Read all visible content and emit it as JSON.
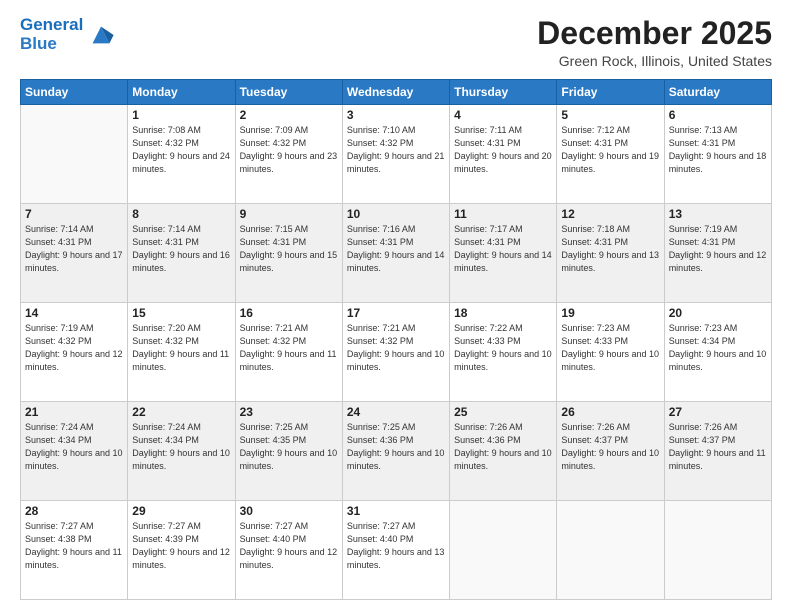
{
  "logo": {
    "line1": "General",
    "line2": "Blue"
  },
  "title": "December 2025",
  "location": "Green Rock, Illinois, United States",
  "weekdays": [
    "Sunday",
    "Monday",
    "Tuesday",
    "Wednesday",
    "Thursday",
    "Friday",
    "Saturday"
  ],
  "weeks": [
    [
      {
        "day": "",
        "sunrise": "",
        "sunset": "",
        "daylight": ""
      },
      {
        "day": "1",
        "sunrise": "Sunrise: 7:08 AM",
        "sunset": "Sunset: 4:32 PM",
        "daylight": "Daylight: 9 hours and 24 minutes."
      },
      {
        "day": "2",
        "sunrise": "Sunrise: 7:09 AM",
        "sunset": "Sunset: 4:32 PM",
        "daylight": "Daylight: 9 hours and 23 minutes."
      },
      {
        "day": "3",
        "sunrise": "Sunrise: 7:10 AM",
        "sunset": "Sunset: 4:32 PM",
        "daylight": "Daylight: 9 hours and 21 minutes."
      },
      {
        "day": "4",
        "sunrise": "Sunrise: 7:11 AM",
        "sunset": "Sunset: 4:31 PM",
        "daylight": "Daylight: 9 hours and 20 minutes."
      },
      {
        "day": "5",
        "sunrise": "Sunrise: 7:12 AM",
        "sunset": "Sunset: 4:31 PM",
        "daylight": "Daylight: 9 hours and 19 minutes."
      },
      {
        "day": "6",
        "sunrise": "Sunrise: 7:13 AM",
        "sunset": "Sunset: 4:31 PM",
        "daylight": "Daylight: 9 hours and 18 minutes."
      }
    ],
    [
      {
        "day": "7",
        "sunrise": "Sunrise: 7:14 AM",
        "sunset": "Sunset: 4:31 PM",
        "daylight": "Daylight: 9 hours and 17 minutes."
      },
      {
        "day": "8",
        "sunrise": "Sunrise: 7:14 AM",
        "sunset": "Sunset: 4:31 PM",
        "daylight": "Daylight: 9 hours and 16 minutes."
      },
      {
        "day": "9",
        "sunrise": "Sunrise: 7:15 AM",
        "sunset": "Sunset: 4:31 PM",
        "daylight": "Daylight: 9 hours and 15 minutes."
      },
      {
        "day": "10",
        "sunrise": "Sunrise: 7:16 AM",
        "sunset": "Sunset: 4:31 PM",
        "daylight": "Daylight: 9 hours and 14 minutes."
      },
      {
        "day": "11",
        "sunrise": "Sunrise: 7:17 AM",
        "sunset": "Sunset: 4:31 PM",
        "daylight": "Daylight: 9 hours and 14 minutes."
      },
      {
        "day": "12",
        "sunrise": "Sunrise: 7:18 AM",
        "sunset": "Sunset: 4:31 PM",
        "daylight": "Daylight: 9 hours and 13 minutes."
      },
      {
        "day": "13",
        "sunrise": "Sunrise: 7:19 AM",
        "sunset": "Sunset: 4:31 PM",
        "daylight": "Daylight: 9 hours and 12 minutes."
      }
    ],
    [
      {
        "day": "14",
        "sunrise": "Sunrise: 7:19 AM",
        "sunset": "Sunset: 4:32 PM",
        "daylight": "Daylight: 9 hours and 12 minutes."
      },
      {
        "day": "15",
        "sunrise": "Sunrise: 7:20 AM",
        "sunset": "Sunset: 4:32 PM",
        "daylight": "Daylight: 9 hours and 11 minutes."
      },
      {
        "day": "16",
        "sunrise": "Sunrise: 7:21 AM",
        "sunset": "Sunset: 4:32 PM",
        "daylight": "Daylight: 9 hours and 11 minutes."
      },
      {
        "day": "17",
        "sunrise": "Sunrise: 7:21 AM",
        "sunset": "Sunset: 4:32 PM",
        "daylight": "Daylight: 9 hours and 10 minutes."
      },
      {
        "day": "18",
        "sunrise": "Sunrise: 7:22 AM",
        "sunset": "Sunset: 4:33 PM",
        "daylight": "Daylight: 9 hours and 10 minutes."
      },
      {
        "day": "19",
        "sunrise": "Sunrise: 7:23 AM",
        "sunset": "Sunset: 4:33 PM",
        "daylight": "Daylight: 9 hours and 10 minutes."
      },
      {
        "day": "20",
        "sunrise": "Sunrise: 7:23 AM",
        "sunset": "Sunset: 4:34 PM",
        "daylight": "Daylight: 9 hours and 10 minutes."
      }
    ],
    [
      {
        "day": "21",
        "sunrise": "Sunrise: 7:24 AM",
        "sunset": "Sunset: 4:34 PM",
        "daylight": "Daylight: 9 hours and 10 minutes."
      },
      {
        "day": "22",
        "sunrise": "Sunrise: 7:24 AM",
        "sunset": "Sunset: 4:34 PM",
        "daylight": "Daylight: 9 hours and 10 minutes."
      },
      {
        "day": "23",
        "sunrise": "Sunrise: 7:25 AM",
        "sunset": "Sunset: 4:35 PM",
        "daylight": "Daylight: 9 hours and 10 minutes."
      },
      {
        "day": "24",
        "sunrise": "Sunrise: 7:25 AM",
        "sunset": "Sunset: 4:36 PM",
        "daylight": "Daylight: 9 hours and 10 minutes."
      },
      {
        "day": "25",
        "sunrise": "Sunrise: 7:26 AM",
        "sunset": "Sunset: 4:36 PM",
        "daylight": "Daylight: 9 hours and 10 minutes."
      },
      {
        "day": "26",
        "sunrise": "Sunrise: 7:26 AM",
        "sunset": "Sunset: 4:37 PM",
        "daylight": "Daylight: 9 hours and 10 minutes."
      },
      {
        "day": "27",
        "sunrise": "Sunrise: 7:26 AM",
        "sunset": "Sunset: 4:37 PM",
        "daylight": "Daylight: 9 hours and 11 minutes."
      }
    ],
    [
      {
        "day": "28",
        "sunrise": "Sunrise: 7:27 AM",
        "sunset": "Sunset: 4:38 PM",
        "daylight": "Daylight: 9 hours and 11 minutes."
      },
      {
        "day": "29",
        "sunrise": "Sunrise: 7:27 AM",
        "sunset": "Sunset: 4:39 PM",
        "daylight": "Daylight: 9 hours and 12 minutes."
      },
      {
        "day": "30",
        "sunrise": "Sunrise: 7:27 AM",
        "sunset": "Sunset: 4:40 PM",
        "daylight": "Daylight: 9 hours and 12 minutes."
      },
      {
        "day": "31",
        "sunrise": "Sunrise: 7:27 AM",
        "sunset": "Sunset: 4:40 PM",
        "daylight": "Daylight: 9 hours and 13 minutes."
      },
      {
        "day": "",
        "sunrise": "",
        "sunset": "",
        "daylight": ""
      },
      {
        "day": "",
        "sunrise": "",
        "sunset": "",
        "daylight": ""
      },
      {
        "day": "",
        "sunrise": "",
        "sunset": "",
        "daylight": ""
      }
    ]
  ]
}
